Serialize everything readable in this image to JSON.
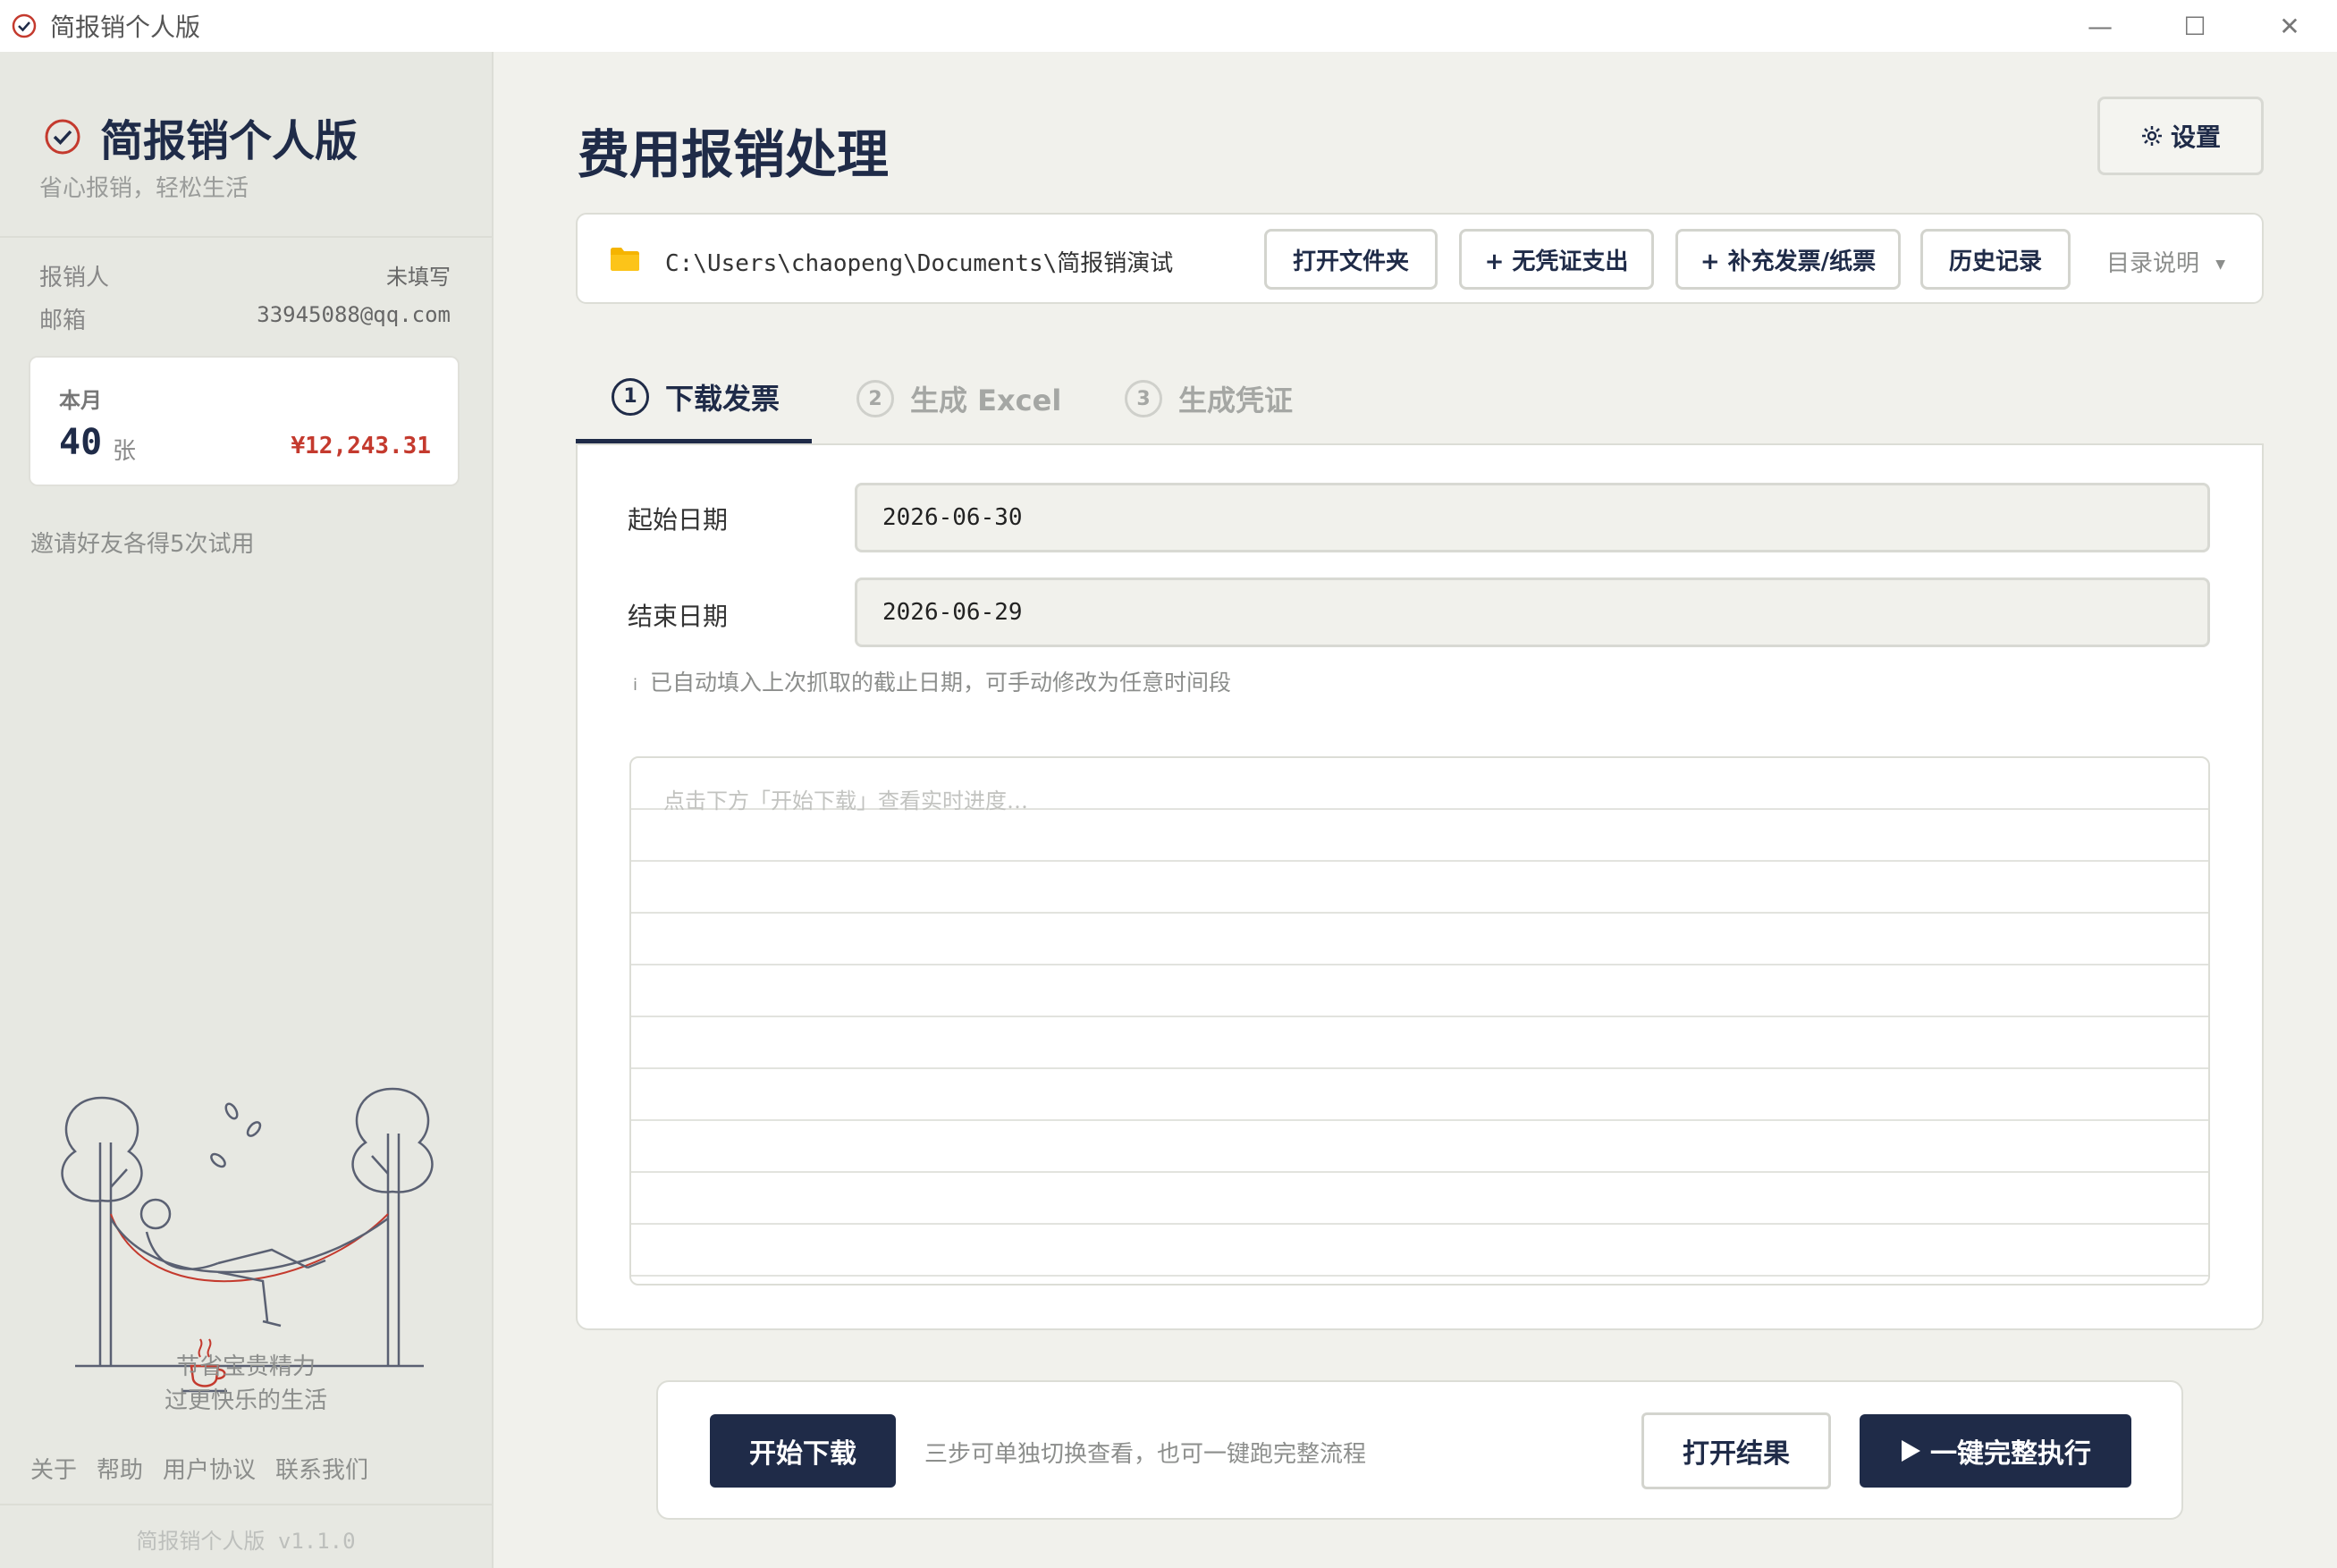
{
  "window": {
    "title": "简报销个人版",
    "minimize": "—",
    "maximize": "☐",
    "close": "✕"
  },
  "sidebar": {
    "brand_name": "简报销个人版",
    "brand_sub": "省心报销，轻松生活",
    "reporter_label": "报销人",
    "reporter_value": "未填写",
    "email_label": "邮箱",
    "email_value": "33945088@qq.com",
    "month_label": "本月",
    "month_count": "40",
    "month_unit": "张",
    "month_amount": "¥12,243.31",
    "invite": "邀请好友各得5次试用",
    "slogan_line1": "节省宝贵精力",
    "slogan_line2": "过更快乐的生活",
    "links": [
      "关于",
      "帮助",
      "用户协议",
      "联系我们"
    ],
    "version": "简报销个人版 v1.1.0"
  },
  "main": {
    "page_title": "费用报销处理",
    "settings_label": "设置",
    "path": "C:\\Users\\chaopeng\\Documents\\简报销演试",
    "buttons": {
      "open_folder": "打开文件夹",
      "no_voucher": "+ 无凭证支出",
      "supplement": "+ 补充发票/纸票",
      "history": "历史记录"
    },
    "dir_help": "目录说明",
    "tabs": [
      {
        "num": "1",
        "label": "下载发票"
      },
      {
        "num": "2",
        "label": "生成 Excel"
      },
      {
        "num": "3",
        "label": "生成凭证"
      }
    ],
    "start_date_label": "起始日期",
    "start_date_value": "2026-06-30",
    "end_date_label": "结束日期",
    "end_date_value": "2026-06-29",
    "hint_icon": "i",
    "hint": "已自动填入上次抓取的截止日期，可手动修改为任意时间段",
    "log_placeholder": "点击下方「开始下载」查看实时进度…",
    "start_download": "开始下载",
    "bottom_tip": "三步可单独切换查看，也可一键跑完整流程",
    "open_result": "打开结果",
    "run_all": "一键完整执行"
  },
  "colors": {
    "primary": "#1f2b48",
    "accent_red": "#c43a2e",
    "folder": "#f5b400"
  }
}
